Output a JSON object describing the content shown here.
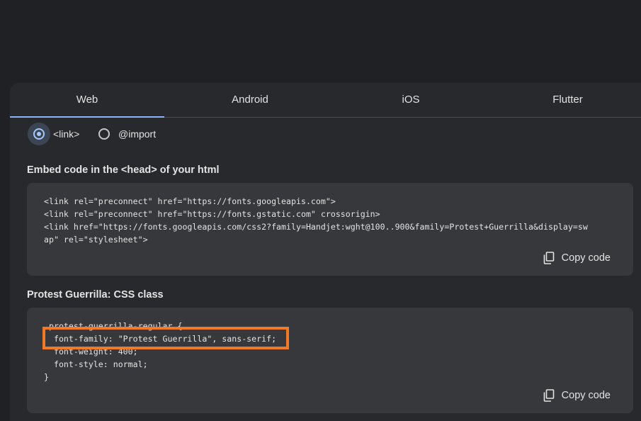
{
  "tabs": [
    {
      "label": "Web",
      "active": true
    },
    {
      "label": "Android",
      "active": false
    },
    {
      "label": "iOS",
      "active": false
    },
    {
      "label": "Flutter",
      "active": false
    }
  ],
  "embed_type": {
    "options": [
      {
        "label": "<link>",
        "checked": true
      },
      {
        "label": "@import",
        "checked": false
      }
    ]
  },
  "embed_section": {
    "title": "Embed code in the <head> of your html",
    "lines": [
      "<link rel=\"preconnect\" href=\"https://fonts.googleapis.com\">",
      "<link rel=\"preconnect\" href=\"https://fonts.gstatic.com\" crossorigin>",
      "<link href=\"https://fonts.googleapis.com/css2?family=Handjet:wght@100..900&family=Protest+Guerrilla&display=sw",
      "ap\" rel=\"stylesheet\">"
    ],
    "copy_label": "Copy code"
  },
  "css_section": {
    "title": "Protest Guerrilla: CSS class",
    "lines": [
      ".protest-guerrilla-regular {",
      "  font-family: \"Protest Guerrilla\", sans-serif;",
      "  font-weight: 400;",
      "  font-style: normal;",
      "}"
    ],
    "copy_label": "Copy code"
  },
  "colors": {
    "accent": "#8ab4f8",
    "highlight": "#f07a28",
    "background": "#202124",
    "panel": "#28292c",
    "codebox": "#37383b"
  },
  "icons": {
    "copy": "copy-icon"
  }
}
